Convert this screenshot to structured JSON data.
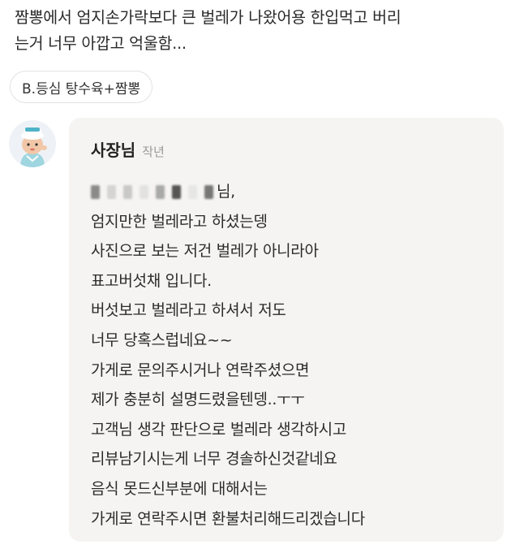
{
  "review": {
    "lines": [
      "짬뽕에서 엄지손가락보다 큰 벌레가 나왔어용 한입먹고 버리",
      "는거 너무 아깝고 억울함..."
    ],
    "menu_chip": "B.등심 탕수육+짬뽕"
  },
  "reply": {
    "author": "사장님",
    "time": "작년",
    "greeting_tail": "님,",
    "lines": [
      "엄지만한 벌레라고 하셨는뎅",
      "사진으로 보는 저건 벌레가 아니라아",
      "표고버섯채 입니다.",
      "버섯보고 벌레라고 하셔서 저도",
      "너무 당혹스럽네요~~",
      "가게로 문의주시거나 연락주셨으면",
      "제가 충분히 설명드렸을텐뎅..ㅜㅜ",
      "고객님 생각 판단으로 벌레라 생각하시고",
      "리뷰남기시는게 너무 경솔하신것같네요",
      "음식 못드신부분에 대해서는",
      "가게로 연락주시면 환불처리해드리겠습니다"
    ]
  },
  "colors": {
    "reply_background": "#f5f4f2",
    "chip_border": "#e2e2e2",
    "muted_text": "#999999"
  },
  "icons": {
    "avatar": "owner-avatar-character"
  }
}
